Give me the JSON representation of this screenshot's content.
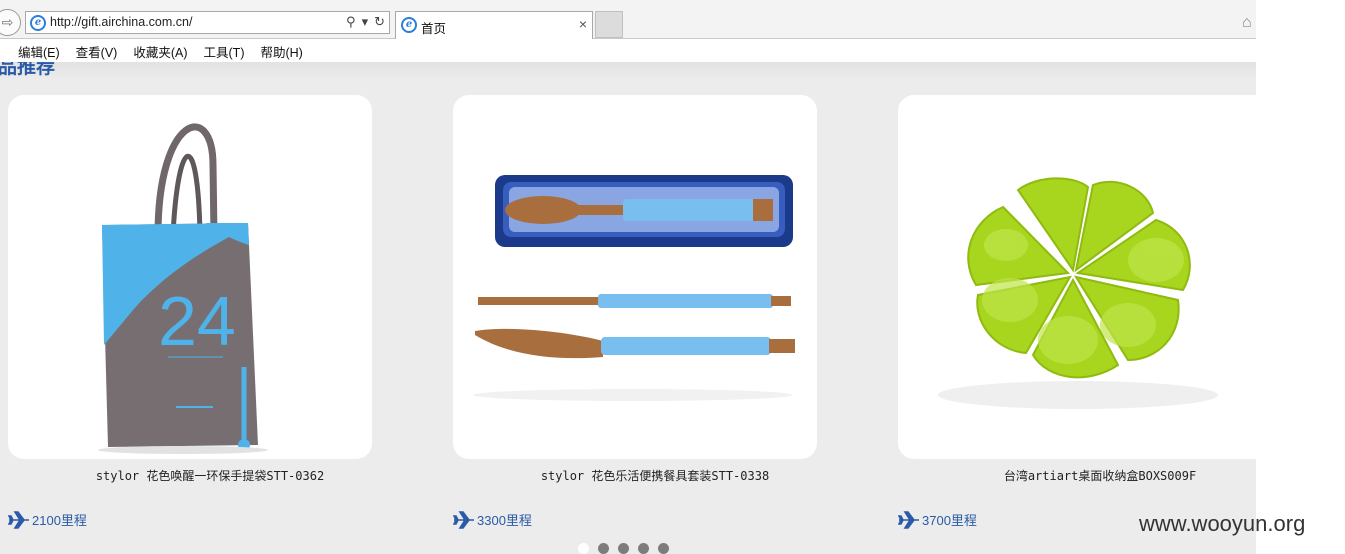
{
  "browser": {
    "url": "http://gift.airchina.com.cn/",
    "tab_title": "首页",
    "tab_close": "×",
    "search_glyph": "⚲",
    "dropdown_glyph": "▾",
    "refresh_glyph": "↻",
    "menu": [
      "编辑(E)",
      "查看(V)",
      "收藏夹(A)",
      "工具(T)",
      "帮助(H)"
    ]
  },
  "page": {
    "section_title": "品推荐",
    "products": [
      {
        "name": "stylor 花色唤醒一环保手提袋STT-0362",
        "price": "2100里程"
      },
      {
        "name": "stylor 花色乐活便携餐具套装STT-0338",
        "price": "3300里程"
      },
      {
        "name": "台湾artiart桌面收纳盒BOXS009F",
        "price": "3700里程"
      }
    ],
    "carousel": {
      "pages": 5,
      "active_index": 0
    }
  },
  "watermark": "www.wooyun.org",
  "colors": {
    "accent": "#2a5aa8",
    "bag_grey": "#776e71",
    "bag_blue": "#4fb3ea",
    "cutlery_blue": "#78bff0",
    "wood": "#a86e3e",
    "bowl_green": "#a8d51e"
  },
  "icons": [
    "back-arrow-icon",
    "ie-logo-icon",
    "search-icon",
    "refresh-icon",
    "close-icon",
    "home-icon",
    "plane-icon"
  ]
}
